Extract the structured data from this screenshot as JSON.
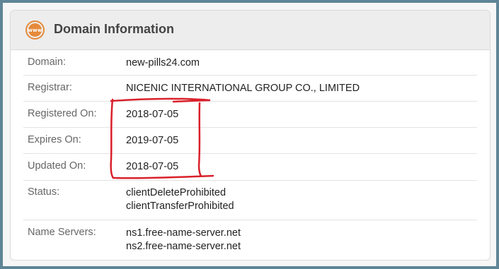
{
  "header": {
    "icon": "www-globe-icon",
    "icon_text": "www",
    "title": "Domain Information"
  },
  "rows": [
    {
      "label": "Domain:",
      "values": [
        "new-pills24.com"
      ]
    },
    {
      "label": "Registrar:",
      "values": [
        "NICENIC INTERNATIONAL GROUP CO., LIMITED"
      ]
    },
    {
      "label": "Registered On:",
      "values": [
        "2018-07-05"
      ]
    },
    {
      "label": "Expires On:",
      "values": [
        "2019-07-05"
      ]
    },
    {
      "label": "Updated On:",
      "values": [
        "2018-07-05"
      ]
    },
    {
      "label": "Status:",
      "values": [
        "clientDeleteProhibited",
        "clientTransferProhibited"
      ]
    },
    {
      "label": "Name Servers:",
      "values": [
        "ns1.free-name-server.net",
        "ns2.free-name-server.net"
      ]
    }
  ],
  "colors": {
    "accent": "#e58a3a",
    "annotation": "#d9202a",
    "border": "#5f8596"
  }
}
